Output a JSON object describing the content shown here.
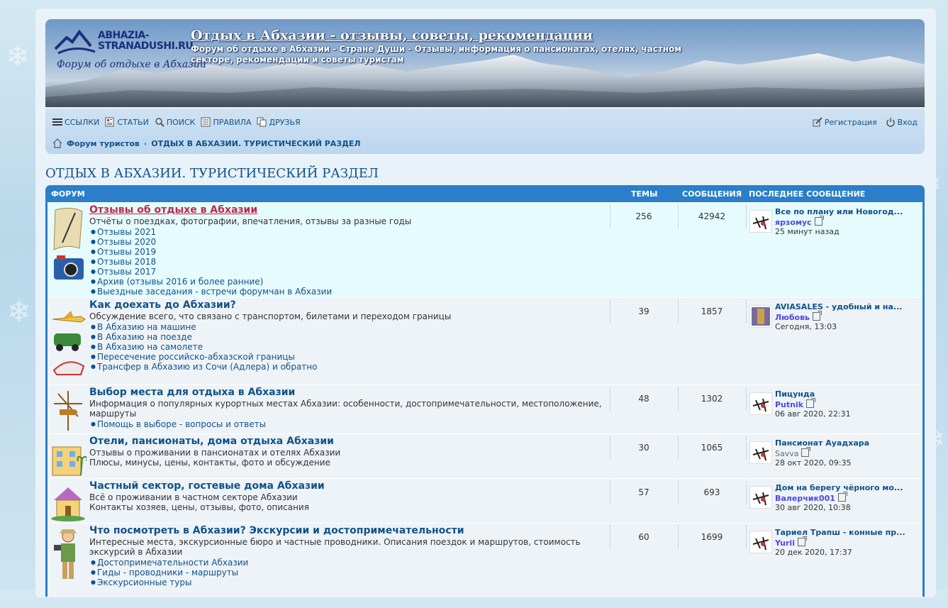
{
  "header": {
    "logo_top": "ABHAZIA-\nSTRANADUSHI.RU",
    "logo_bottom": "Форум об отдыхе в Абхазии",
    "title": "Отдых в Абхазии - отзывы, советы, рекомендации",
    "description": "Форум об отдыхе в Абхазии - Стране Души - Отзывы, информация о пансионатах, отелях, частном секторе, рекомендации и советы туристам"
  },
  "nav": {
    "links": "ССЫЛКИ",
    "articles": "СТАТЬИ",
    "search": "ПОИСК",
    "rules": "ПРАВИЛА",
    "friends": "ДРУЗЬЯ",
    "register": "Регистрация",
    "login": "Вход"
  },
  "breadcrumb": {
    "home": "Форум туристов",
    "current": "ОТДЫХ В АБХАЗИИ. ТУРИСТИЧЕСКИЙ РАЗДЕЛ"
  },
  "page_title": "ОТДЫХ В АБХАЗИИ. ТУРИСТИЧЕСКИЙ РАЗДЕЛ",
  "table_head": {
    "forum": "ФОРУМ",
    "topics": "ТЕМЫ",
    "posts": "СООБЩЕНИЯ",
    "last": "ПОСЛЕДНЕЕ СООБЩЕНИЕ"
  },
  "forums": [
    {
      "title": "Отзывы об отдыхе в Абхазии",
      "desc": "Отчёты о поездках, фотографии, впечатления, отзывы за разные годы",
      "subs": [
        "Отзывы 2021",
        "Отзывы 2020",
        "Отзывы 2019",
        "Отзывы 2018",
        "Отзывы 2017",
        "Архив (отзывы 2016 и более ранние)",
        "Выездные заседания - встречи форумчан в Абхазии"
      ],
      "topics": "256",
      "posts": "42942",
      "last_title": "Все по плану или Новогод...",
      "last_user": "ярзомус",
      "last_time": "25 минут назад"
    },
    {
      "title": "Как доехать до Абхазии?",
      "desc": "Обсуждение всего, что связано с транспортом, билетами и переходом границы",
      "subs": [
        "В Абхазию на машине",
        "В Абхазию на поезде",
        "В Абхазию на самолете",
        "Пересечение российско-абхазской границы",
        "Трансфер в Абхазию из Сочи (Адлера) и обратно"
      ],
      "topics": "39",
      "posts": "1857",
      "last_title": "AVIASALES - удобный и на...",
      "last_user": "Любовь",
      "last_time": "Сегодня, 13:03"
    },
    {
      "title": "Выбор места для отдыха в Абхазии",
      "desc": "Информация о популярных курортных местах Абхазии: особенности, достопримечательности, местоположение, маршруты",
      "subs": [
        "Помощь в выборе - вопросы и ответы"
      ],
      "topics": "48",
      "posts": "1302",
      "last_title": "Пицунда",
      "last_user": "Putnik",
      "last_time": "06 авг 2020, 22:31"
    },
    {
      "title": "Отели, пансионаты, дома отдыха Абхазии",
      "desc": "Отзывы о проживании в пансионатах и отелях Абхазии\nПлюсы, минусы, цены, контакты, фото и обсуждение",
      "subs": [],
      "topics": "30",
      "posts": "1065",
      "last_title": "Пансионат Ауадхара",
      "last_user": "Savva",
      "last_time": "28 окт 2020, 09:35"
    },
    {
      "title": "Частный сектор, гостевые дома Абхазии",
      "desc": "Всё о проживании в частном секторе Абхазии\nКонтакты хозяев, цены, отзывы, фото, описания",
      "subs": [],
      "topics": "57",
      "posts": "693",
      "last_title": "Дом на берегу чёрного мо...",
      "last_user": "Валерчик001",
      "last_time": "30 авг 2020, 10:38"
    },
    {
      "title": "Что посмотреть в Абхазии? Экскурсии и достопримечательности",
      "desc": "Интересные места, экскурсионные бюро и частные проводники. Описания поездок и маршрутов, стоимость экскурсий в Абхазии",
      "subs": [
        "Достопримечательности Абхазии",
        "Гиды - проводники - маршруты",
        "Экскурсионные туры"
      ],
      "topics": "60",
      "posts": "1699",
      "last_title": "Тариел Трапш - конные пр...",
      "last_user": "Yurii",
      "last_time": "20 дек 2020, 17:37"
    }
  ]
}
